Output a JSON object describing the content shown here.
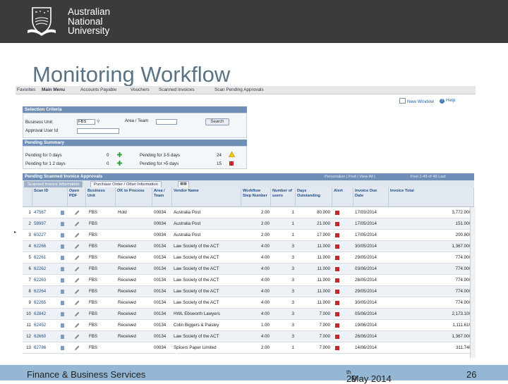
{
  "header": {
    "brand_lines": [
      "Australian",
      "National",
      "University"
    ]
  },
  "slide": {
    "title": "Monitoring Workflow"
  },
  "screenshot": {
    "breadcrumb": [
      "Favorites",
      "Main Menu",
      "Accounts Payable",
      "Vouchers",
      "Scanned Invoices",
      "Scan Pending Approvals"
    ],
    "top_links": {
      "new_window": "New Window",
      "help": "Help"
    },
    "selection": {
      "header": "Selection Criteria",
      "business_unit_label": "Business Unit:",
      "business_unit_value": "FBS",
      "area_team_label": "Area / Team",
      "approval_user_label": "Approval User Id",
      "search_button": "Search"
    },
    "summary": {
      "header": "Pending Summary",
      "items": [
        {
          "label": "Pending for 0 days",
          "count": "0",
          "status": "green"
        },
        {
          "label": "Pending for 1 2 days",
          "count": "0",
          "status": "green"
        },
        {
          "label": "Pending for 3-5 days",
          "count": "24",
          "status": "yellow"
        },
        {
          "label": "Pending for >5 days",
          "count": "15",
          "status": "red"
        }
      ]
    },
    "grid": {
      "header": "Pending Scanned Invoice Approvals",
      "header_right": "Personalize | Find | View All | ",
      "pager": "First  1-49 of 49  Last",
      "tabs": [
        "Scanned Invoice Information",
        "Purchase Order / Other Information"
      ],
      "columns": [
        "",
        "Scan ID",
        "Open PDF",
        "Business Unit",
        "OK to Process",
        "Area / Team",
        "Vendor Name",
        "Workflow Step Number",
        "Number of users",
        "Days Outstanding",
        "Alert",
        "Invoice Due Date",
        "Invoice Total"
      ],
      "rows": [
        {
          "n": "1",
          "scan": "47567",
          "bu": "FBS",
          "ok": "Hold",
          "area": "00034",
          "vendor": "Australia Post",
          "step": "2.00",
          "users": "1",
          "days": "80.000",
          "due": "17/03/2014",
          "total": "3,772.000"
        },
        {
          "n": "2",
          "scan": "58997",
          "bu": "FBS",
          "ok": "",
          "area": "00034",
          "vendor": "Australia Post",
          "step": "2.00",
          "users": "1",
          "days": "21.000",
          "due": "17/05/2014",
          "total": "151.000"
        },
        {
          "n": "3",
          "scan": "60227",
          "bu": "FBS",
          "ok": "",
          "area": "00034",
          "vendor": "Australia Post",
          "step": "2.00",
          "users": "1",
          "days": "17.000",
          "due": "17/05/2014",
          "total": "200.800"
        },
        {
          "n": "4",
          "scan": "62266",
          "bu": "FBS",
          "ok": "Received",
          "area": "00134",
          "vendor": "Law Society of the ACT",
          "step": "4.00",
          "users": "3",
          "days": "11.000",
          "due": "30/05/2014",
          "total": "1,367.000"
        },
        {
          "n": "5",
          "scan": "62261",
          "bu": "FBS",
          "ok": "Received",
          "area": "00134",
          "vendor": "Law Society of the ACT",
          "step": "4.00",
          "users": "3",
          "days": "11.000",
          "due": "29/05/2014",
          "total": "774.000"
        },
        {
          "n": "6",
          "scan": "62262",
          "bu": "FBS",
          "ok": "Received",
          "area": "00134",
          "vendor": "Law Society of the ACT",
          "step": "4.00",
          "users": "3",
          "days": "11.000",
          "due": "03/06/2014",
          "total": "774.000"
        },
        {
          "n": "7",
          "scan": "62263",
          "bu": "FBS",
          "ok": "Received",
          "area": "00134",
          "vendor": "Law Society of the ACT",
          "step": "4.00",
          "users": "3",
          "days": "11.000",
          "due": "28/05/2014",
          "total": "774.000"
        },
        {
          "n": "8",
          "scan": "62264",
          "bu": "FBS",
          "ok": "Received",
          "area": "00134",
          "vendor": "Law Society of the ACT",
          "step": "4.00",
          "users": "3",
          "days": "11.000",
          "due": "29/05/2014",
          "total": "774.000"
        },
        {
          "n": "9",
          "scan": "62265",
          "bu": "FBS",
          "ok": "Received",
          "area": "00134",
          "vendor": "Law Society of the ACT",
          "step": "4.00",
          "users": "3",
          "days": "11.000",
          "due": "30/05/2014",
          "total": "774.000"
        },
        {
          "n": "10",
          "scan": "62842",
          "bu": "FBS",
          "ok": "Received",
          "area": "00134",
          "vendor": "HWL Ebsworth Lawyers",
          "step": "4.00",
          "users": "3",
          "days": "7.000",
          "due": "05/06/2014",
          "total": "2,173.100"
        },
        {
          "n": "11",
          "scan": "62452",
          "bu": "FBS",
          "ok": "Received",
          "area": "00134",
          "vendor": "Colin Biggers & Paisley",
          "step": "1.00",
          "users": "3",
          "days": "7.000",
          "due": "19/06/2014",
          "total": "1,111.610"
        },
        {
          "n": "12",
          "scan": "62660",
          "bu": "FBS",
          "ok": "Received",
          "area": "00134",
          "vendor": "Law Society of the ACT",
          "step": "4.00",
          "users": "3",
          "days": "7.000",
          "due": "26/06/2014",
          "total": "1,367.000"
        },
        {
          "n": "13",
          "scan": "62786",
          "bu": "FBS",
          "ok": "",
          "area": "00034",
          "vendor": "Spicers Paper Limited",
          "step": "2.00",
          "users": "1",
          "days": "7.000",
          "due": "14/06/2014",
          "total": "311.740"
        }
      ]
    }
  },
  "footer": {
    "left": "Finance & Business Services",
    "date_day": "29",
    "date_suffix": "th",
    "date_rest": " May 2014",
    "page": "26"
  },
  "colors": {
    "topbar": "#3b3b3b",
    "title": "#5a7384",
    "panel_header": "#6f8fb7",
    "footer": "#93b7d4",
    "alert_red": "#c62828"
  }
}
